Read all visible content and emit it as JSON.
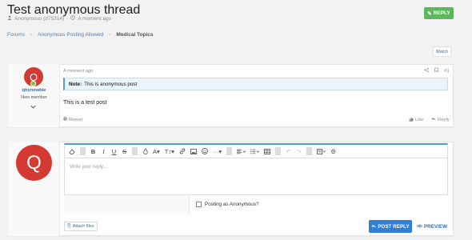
{
  "thread": {
    "title": "Test anonymous thread",
    "author": "Anonymous (d75314)",
    "separator": "·",
    "time": "A moment ago",
    "reply_label": "REPLY"
  },
  "breadcrumb": [
    "Forums",
    "Anonymous Posting Allowed",
    "Medical Topics"
  ],
  "watch_label": "Watch",
  "post": {
    "avatar_letter": "Q",
    "username": "qbynewbie",
    "role": "New member",
    "time": "A moment ago",
    "number": "#1",
    "note_label": "Note:",
    "note_text": "This is anonymous post",
    "body": "This is a test post",
    "report_label": "Report",
    "like_label": "Like",
    "reply_label": "Reply"
  },
  "reply_form": {
    "avatar_letter": "Q",
    "placeholder": "Write your reply...",
    "anonymous_label": "Posting as Anonymous?",
    "attach_label": "Attach files",
    "post_reply_label": "POST REPLY",
    "preview_label": "PREVIEW"
  },
  "colors": {
    "accent": "#2f7fd6",
    "reply_green": "#5cb85c",
    "avatar_red": "#d43a32",
    "online_green": "#7fbd3a"
  }
}
